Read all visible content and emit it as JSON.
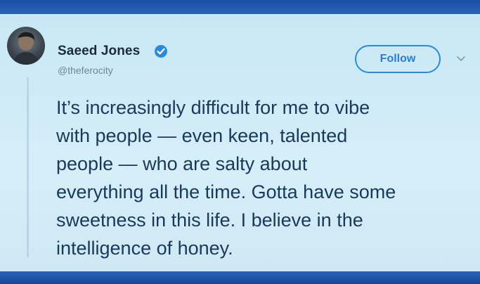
{
  "tweet": {
    "author": {
      "display_name": "Saeed Jones",
      "handle": "@theferocity",
      "verified": true,
      "avatar_icon": "user-photo-avatar"
    },
    "follow_label": "Follow",
    "menu_icon": "chevron-down-icon",
    "text_lines": [
      "It’s increasingly difficult for me to vibe",
      "with people — even keen, talented",
      "people — who are salty about",
      "everything all the time. Gotta have some",
      "sweetness in this life. I believe in the",
      "intelligence of honey."
    ]
  },
  "colors": {
    "accent": "#2a8bd6",
    "text": "#19395a",
    "background": "#cfe9f5",
    "frame": "#1a4ea3"
  }
}
